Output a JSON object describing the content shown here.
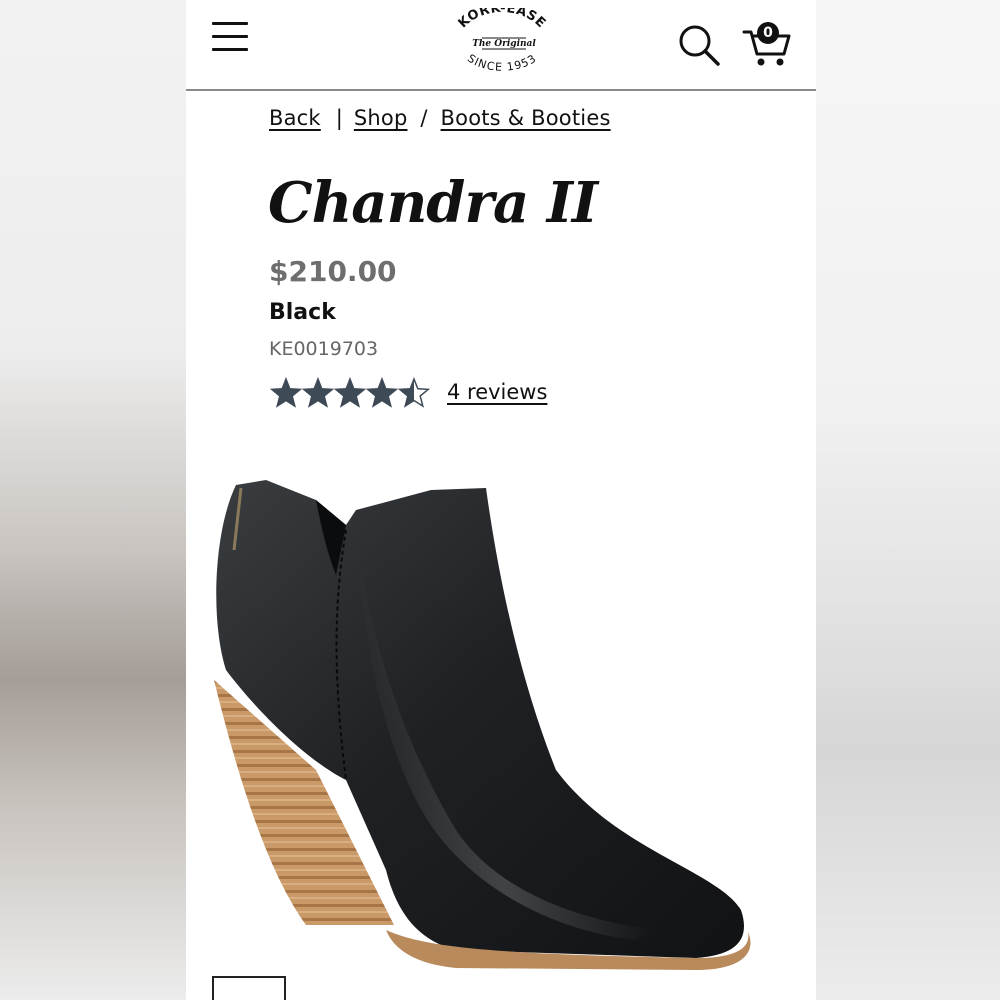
{
  "header": {
    "logo": {
      "top_text": "KORK-EASE",
      "middle_text": "The Original",
      "bottom_text": "SINCE 1953"
    },
    "cart_count": "0",
    "icons": {
      "menu": "hamburger-menu-icon",
      "search": "search-icon",
      "cart": "shopping-cart-icon"
    }
  },
  "breadcrumb": {
    "back": "Back",
    "divider": "|",
    "shop": "Shop",
    "slash": "/",
    "category": "Boots & Booties"
  },
  "product": {
    "name": "Chandra II",
    "price": "$210.00",
    "color": "Black",
    "sku": "KE0019703",
    "rating": 4.5,
    "rating_max": 5,
    "reviews_label": "4 reviews"
  },
  "colors": {
    "star": "#3f4a57",
    "price": "#6e6e6e",
    "text": "#111111"
  }
}
